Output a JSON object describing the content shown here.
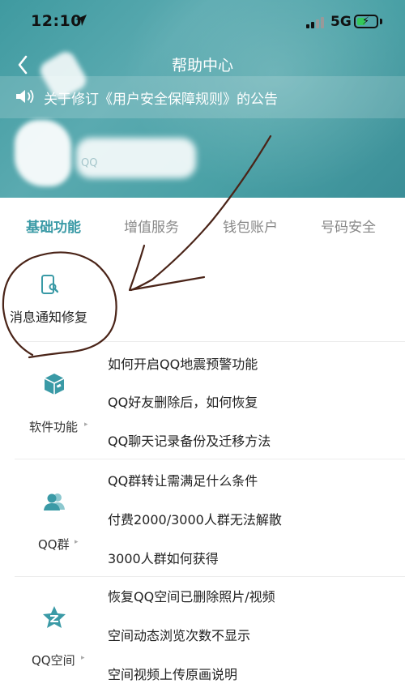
{
  "status_bar": {
    "time": "12:10",
    "network": "5G",
    "battery_level": 0.45,
    "signal_bars": 2
  },
  "nav": {
    "title": "帮助中心",
    "back_icon": "chevron-left-icon"
  },
  "notice": {
    "icon": "speaker-icon",
    "text": "关于修订《用户安全保障规则》的公告"
  },
  "profile": {
    "faint_text": "QQ"
  },
  "tabs": [
    {
      "label": "基础功能",
      "active": true
    },
    {
      "label": "增值服务",
      "active": false
    },
    {
      "label": "钱包账户",
      "active": false
    },
    {
      "label": "号码安全",
      "active": false
    }
  ],
  "featured": {
    "icon": "phone-wrench-icon",
    "label": "消息通知修复"
  },
  "categories": [
    {
      "label": "软件功能",
      "icon": "cube-icon",
      "caret": "▸",
      "questions": [
        "如何开启QQ地震预警功能",
        "QQ好友删除后，如何恢复",
        "QQ聊天记录备份及迁移方法"
      ]
    },
    {
      "label": "QQ群",
      "icon": "group-icon",
      "caret": "▸",
      "questions": [
        "QQ群转让需满足什么条件",
        "付费2000/3000人群无法解散",
        "3000人群如何获得"
      ]
    },
    {
      "label": "QQ空间",
      "icon": "qzone-star-icon",
      "caret": "▸",
      "questions": [
        "恢复QQ空间已删除照片/视频",
        "空间动态浏览次数不显示",
        "空间视频上传原画说明"
      ]
    }
  ],
  "colors": {
    "accent": "#3a9aa6",
    "header_teal": "#4aa1a6",
    "annotation_brown": "#4a2418"
  }
}
